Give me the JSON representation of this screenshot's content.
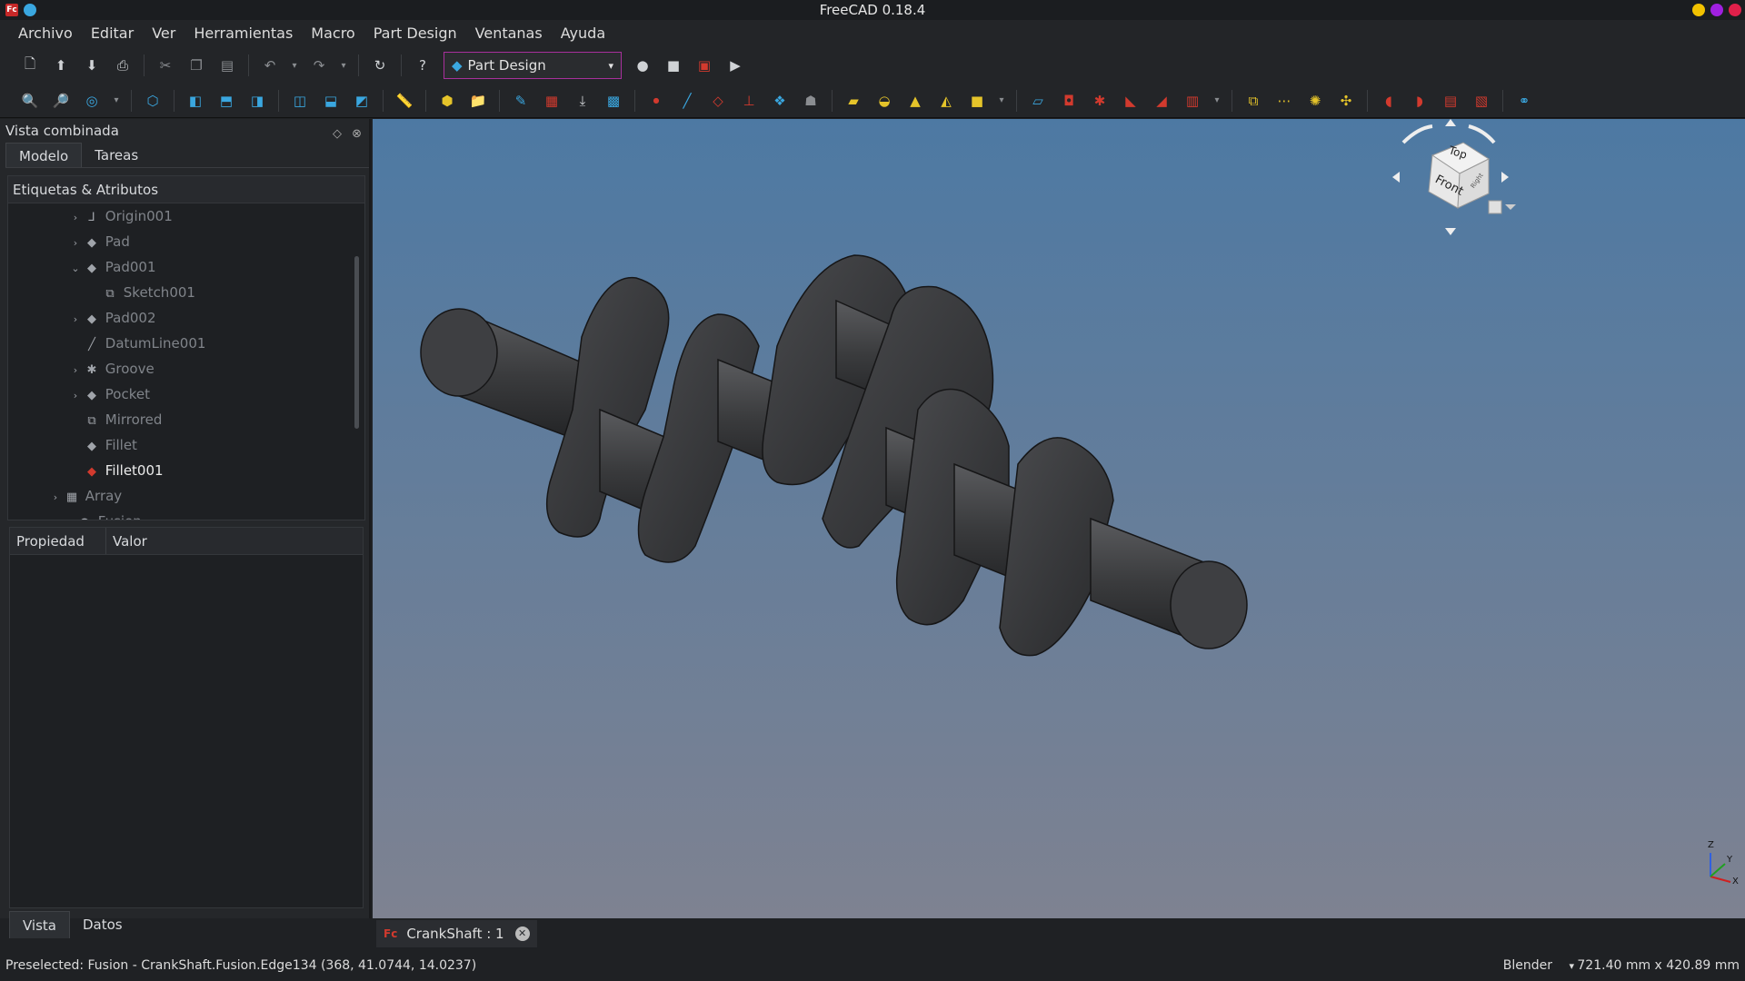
{
  "window": {
    "title": "FreeCAD 0.18.4"
  },
  "menu": [
    "Archivo",
    "Editar",
    "Ver",
    "Herramientas",
    "Macro",
    "Part Design",
    "Ventanas",
    "Ayuda"
  ],
  "workbench": {
    "selected": "Part Design"
  },
  "combo_view": {
    "title": "Vista combinada",
    "tabs": [
      "Modelo",
      "Tareas"
    ],
    "tree_header": "Etiquetas & Atributos",
    "tree_items": [
      {
        "label": "Origin001",
        "icon": "origin-icon"
      },
      {
        "label": "Pad",
        "icon": "pad-icon"
      },
      {
        "label": "Pad001",
        "icon": "pad-icon"
      },
      {
        "label": "Sketch001",
        "icon": "sketch-icon"
      },
      {
        "label": "Pad002",
        "icon": "pad-icon"
      },
      {
        "label": "DatumLine001",
        "icon": "datum-line-icon"
      },
      {
        "label": "Groove",
        "icon": "groove-icon"
      },
      {
        "label": "Pocket",
        "icon": "pocket-icon"
      },
      {
        "label": "Mirrored",
        "icon": "mirrored-icon"
      },
      {
        "label": "Fillet",
        "icon": "fillet-icon"
      },
      {
        "label": "Fillet001",
        "icon": "fillet-icon"
      },
      {
        "label": "Array",
        "icon": "array-icon"
      },
      {
        "label": "Fusion",
        "icon": "fusion-icon"
      }
    ],
    "property_headers": [
      "Propiedad",
      "Valor"
    ],
    "bottom_tabs": [
      "Vista",
      "Datos"
    ]
  },
  "navcube": {
    "top": "Top",
    "front": "Front",
    "right": "Right"
  },
  "axis": {
    "x": "X",
    "y": "Y",
    "z": "Z"
  },
  "document_tab": {
    "label": "CrankShaft : 1"
  },
  "status": {
    "message": "Preselected: Fusion - CrankShaft.Fusion.Edge134 (368, 41.0744, 14.0237)",
    "navigation": "Blender",
    "dimensions": "721.40 mm x 420.89 mm"
  },
  "colors": {
    "accent": "#a8309c",
    "viewport_top": "#4d79a3",
    "viewport_bottom": "#7e8291",
    "icon_blue": "#3aa7e0",
    "icon_red": "#d23a2e",
    "icon_yellow": "#e5c42a"
  }
}
